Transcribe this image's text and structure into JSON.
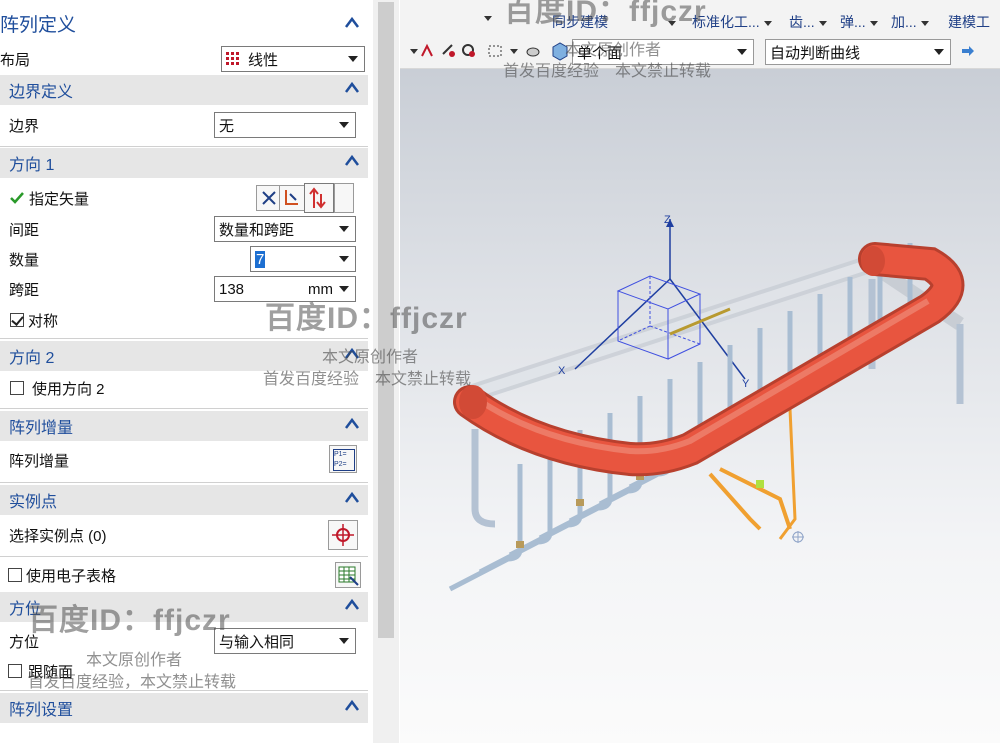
{
  "panel": {
    "title": "阵列定义",
    "layout_label": "布局",
    "layout_value": "线性",
    "sections": {
      "boundary": {
        "title": "边界定义",
        "label": "边界",
        "value": "无"
      },
      "direction1": {
        "title": "方向 1",
        "vector_label": "指定矢量",
        "spacing_label": "间距",
        "spacing_value": "数量和跨距",
        "count_label": "数量",
        "count_value": "7",
        "span_label": "跨距",
        "span_value": "138",
        "span_unit": "mm",
        "symmetric_label": "对称"
      },
      "direction2": {
        "title": "方向 2",
        "use_label": "使用方向 2"
      },
      "increment": {
        "title": "阵列增量",
        "label": "阵列增量",
        "icon_text": "P1= P2="
      },
      "instance": {
        "title": "实例点",
        "label": "选择实例点 (0)"
      },
      "spreadsheet": {
        "label": "使用电子表格"
      },
      "orientation": {
        "title": "方位",
        "label": "方位",
        "value": "与输入相同",
        "follow_label": "跟随面"
      },
      "settings": {
        "title": "阵列设置"
      }
    }
  },
  "toolbar": {
    "menus": [
      "同步建模",
      "标准化工...",
      "齿...",
      "弹...",
      "加...",
      "建模工"
    ],
    "face_filter": "单个面",
    "curve_rule": "自动判断曲线"
  },
  "viewport": {
    "axis_labels": {
      "z": "Z",
      "x": "X",
      "y": "Y"
    }
  },
  "watermarks": {
    "id_text": "百度ID：ffjczr",
    "line1": "本文原创作者",
    "line2": "首发百度经验　本文禁止转载",
    "line2b": "首发百度经验，本文禁止转载"
  },
  "colors": {
    "section_title": "#1f4e9c",
    "pipe_red": "#e8553f",
    "bars": "#a9bdd2",
    "orange_path": "#f0a030"
  }
}
